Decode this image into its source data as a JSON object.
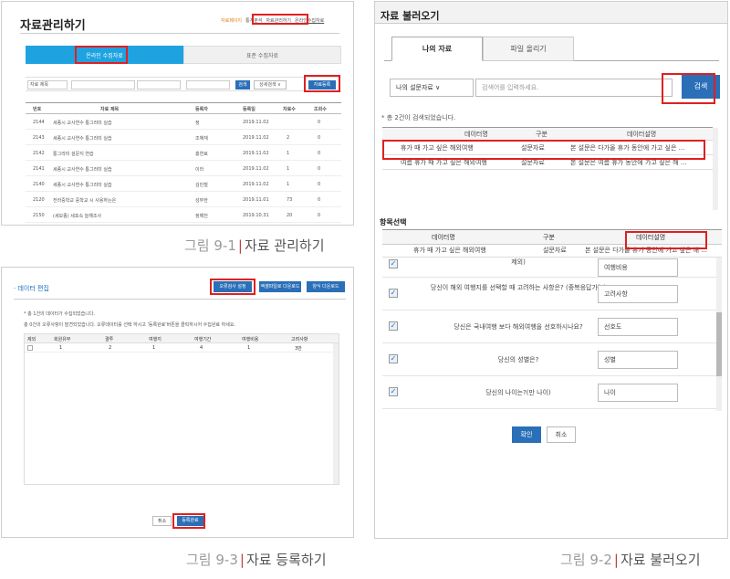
{
  "captions": {
    "fig1": {
      "num": "그림 9-1",
      "text": "자료 관리하기"
    },
    "fig3": {
      "num": "그림 9-3",
      "text": "자료 등록하기"
    },
    "fig2": {
      "num": "그림 9-2",
      "text": "자료 불러오기"
    }
  },
  "p1": {
    "title": "자료관리하기",
    "links": [
      "자료페이지",
      "통계분석",
      "자료관리하기",
      "온라인수집자료"
    ],
    "tabs": [
      "온라인 수집자료",
      "표준 수집자료"
    ],
    "filter": {
      "select": "자료 제목",
      "search_btn": "검색",
      "detail_btn": "상세검색 ∨",
      "register_btn": "자료등록"
    },
    "headers": [
      "번호",
      "자료 제목",
      "등록자",
      "등록일",
      "자료수",
      "조회수"
    ],
    "rows": [
      [
        "2144",
        "세종시 교사연수 통그라미 실습",
        "정",
        "2019.11.02",
        "",
        "0"
      ],
      [
        "2143",
        "세종시 교사연수 통그라미 실습",
        "조혜재",
        "2019.11.02",
        "2",
        "0"
      ],
      [
        "2142",
        "통그라미 설문지 연습",
        "홍연료",
        "2019.11.02",
        "1",
        "0"
      ],
      [
        "2141",
        "세종시 교사연수 통그라미 실습",
        "이라",
        "2019.11.02",
        "1",
        "0"
      ],
      [
        "2140",
        "세종시 교사연수 통그라미 실습",
        "김민철",
        "2019.11.02",
        "1",
        "0"
      ],
      [
        "2120",
        "전라중학교 중학교 시 사용하는은",
        "성무한",
        "2019.11.01",
        "73",
        "0"
      ],
      [
        "2150",
        "(세모종) 세포속 늘해조사",
        "정해천",
        "2019.10.31",
        "20",
        "0"
      ]
    ]
  },
  "p3": {
    "title": "· 데이터 편집",
    "buttons": [
      "오류검사 설정",
      "엑셀파일로 다운로드",
      "양식 다운로드"
    ],
    "info1": "* 총 1건의 데이터가 수집되었습니다.",
    "info2": "총 0건의 오류사항이 발견되었습니다. 오류데이터를 선택 하시고 '등록완료'버튼을 클릭하시어 수집완료 하세요.",
    "headers": [
      "제외",
      "회원유무",
      "결투",
      "여행지",
      "여행기간",
      "여행비용",
      "고려사항"
    ],
    "row": [
      "",
      "1",
      "2",
      "1",
      "4",
      "1",
      "3만"
    ],
    "cancel": "취소",
    "submit": "등록완료"
  },
  "p2": {
    "title": "자료 불러오기",
    "tabs": [
      "나의 자료",
      "파일 올리기"
    ],
    "select": "나의 설문자료 ∨",
    "placeholder": "검색어를 입력하세요.",
    "search_btn": "검색",
    "count": "* 총 2건이 검색되었습니다.",
    "headers": [
      "데이터명",
      "구분",
      "데이터설명"
    ],
    "results": [
      [
        "휴가 때 가고 싶은 해외여행",
        "설문자료",
        "본 설문은 다가올 휴가 동안에 가고 싶은 ..."
      ],
      [
        "여름 휴가 때 가고 싶은 해외여행",
        "설문자료",
        "본 설문은 여름 휴가 동안에 가고 싶은 해 ..."
      ]
    ],
    "section": "항목선택",
    "item_headers": [
      "데이터명",
      "구분",
      "데이터설명"
    ],
    "item_selected": [
      "휴가 때 가고 싶은 해외여행",
      "설문자료",
      "본 설문은 다가올 휴가 동안에 가고 싶은 해 ..."
    ],
    "items": [
      {
        "q": "제외)",
        "a": "여행비용"
      },
      {
        "q": "당신이 해외 여행지를 선택할 때 고려하는 사항은? (중복응답가능)",
        "a": "고려사항"
      },
      {
        "q": "당신은 국내여행 보다 해외여행을 선호하시나요?",
        "a": "선호도"
      },
      {
        "q": "당신의 성별은?",
        "a": "성별"
      },
      {
        "q": "당신의 나이는?(만 나이)",
        "a": "나이"
      }
    ],
    "ok": "확인",
    "cancel": "취소"
  }
}
